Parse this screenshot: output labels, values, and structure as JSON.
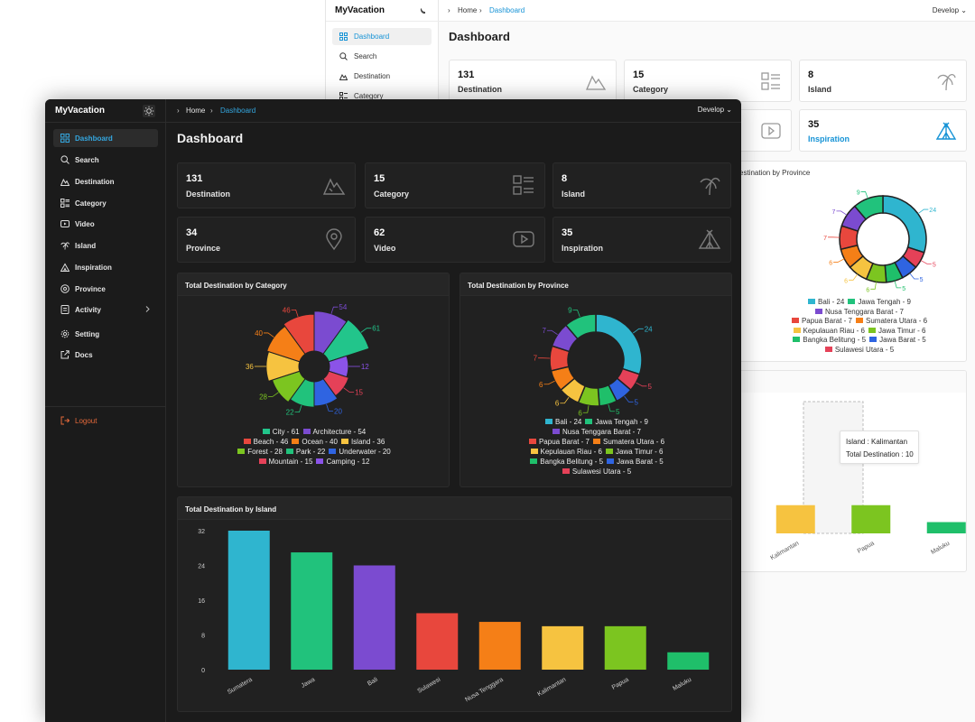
{
  "app": {
    "name": "MyVacation",
    "environment": "Develop"
  },
  "breadcrumb": {
    "home": "Home",
    "current": "Dashboard"
  },
  "page_title": "Dashboard",
  "sidebar": {
    "items": [
      {
        "label": "Dashboard",
        "icon": "dashboard-icon"
      },
      {
        "label": "Search",
        "icon": "search-icon"
      },
      {
        "label": "Destination",
        "icon": "mountain-icon"
      },
      {
        "label": "Category",
        "icon": "category-list-icon"
      },
      {
        "label": "Video",
        "icon": "video-icon"
      },
      {
        "label": "Island",
        "icon": "palm-tree-icon"
      },
      {
        "label": "Inspiration",
        "icon": "tent-icon"
      },
      {
        "label": "Province",
        "icon": "map-pin-icon"
      },
      {
        "label": "Activity",
        "icon": "activity-icon"
      },
      {
        "label": "Setting",
        "icon": "gear-icon"
      },
      {
        "label": "Docs",
        "icon": "external-link-icon"
      }
    ],
    "logout": "Logout"
  },
  "stats": [
    {
      "value": "131",
      "label": "Destination",
      "icon": "mountain-icon"
    },
    {
      "value": "15",
      "label": "Category",
      "icon": "category-list-icon"
    },
    {
      "value": "8",
      "label": "Island",
      "icon": "palm-tree-icon"
    },
    {
      "value": "34",
      "label": "Province",
      "icon": "map-pin-icon"
    },
    {
      "value": "62",
      "label": "Video",
      "icon": "video-icon"
    },
    {
      "value": "35",
      "label": "Inspiration",
      "icon": "tent-icon"
    }
  ],
  "light_window": {
    "nav": [
      "Dashboard",
      "Search",
      "Destination",
      "Category"
    ],
    "tooltip": {
      "line1": "Island : Kalimantan",
      "line2": "Total Destination : 10"
    },
    "province_title_fragment": "estination by Province"
  },
  "colors": {
    "accent": "#34a7e0",
    "bg_dark": "#1b1b1b",
    "panel_dark": "#212121",
    "logout": "#e5693a"
  },
  "chart_data": [
    {
      "type": "pie",
      "title": "Total Destination by Category",
      "series": [
        {
          "name": "City",
          "value": 61,
          "color": "#22c58b"
        },
        {
          "name": "Architecture",
          "value": 54,
          "color": "#7b4bd0"
        },
        {
          "name": "Beach",
          "value": 46,
          "color": "#e8473d"
        },
        {
          "name": "Ocean",
          "value": 40,
          "color": "#f57f17"
        },
        {
          "name": "Island",
          "value": 36,
          "color": "#f6c340"
        },
        {
          "name": "Forest",
          "value": 28,
          "color": "#7cc520"
        },
        {
          "name": "Park",
          "value": 22,
          "color": "#21c27c"
        },
        {
          "name": "Underwater",
          "value": 20,
          "color": "#2f64e1"
        },
        {
          "name": "Mountain",
          "value": 15,
          "color": "#e54158"
        },
        {
          "name": "Camping",
          "value": 12,
          "color": "#8b53e8"
        }
      ],
      "order": [
        "Architecture",
        "City",
        "Camping",
        "Mountain",
        "Underwater",
        "Park",
        "Forest",
        "Island",
        "Ocean",
        "Beach"
      ]
    },
    {
      "type": "pie",
      "title": "Total Destination by Province",
      "series": [
        {
          "name": "Bali",
          "value": 24,
          "color": "#2fb5cf"
        },
        {
          "name": "Jawa Tengah",
          "value": 9,
          "color": "#21c27c"
        },
        {
          "name": "Nusa Tenggara Barat",
          "value": 7,
          "color": "#7b4bd0"
        },
        {
          "name": "Papua Barat",
          "value": 7,
          "color": "#e8473d"
        },
        {
          "name": "Sumatera Utara",
          "value": 6,
          "color": "#f57f17"
        },
        {
          "name": "Kepulauan Riau",
          "value": 6,
          "color": "#f6c340"
        },
        {
          "name": "Jawa Timur",
          "value": 6,
          "color": "#7cc520"
        },
        {
          "name": "Bangka Belitung",
          "value": 5,
          "color": "#1fbf6a"
        },
        {
          "name": "Jawa Barat",
          "value": 5,
          "color": "#2f64e1"
        },
        {
          "name": "Sulawesi Utara",
          "value": 5,
          "color": "#e54158"
        }
      ],
      "order": [
        "Bali",
        "Sulawesi Utara",
        "Jawa Barat",
        "Bangka Belitung",
        "Jawa Timur",
        "Kepulauan Riau",
        "Sumatera Utara",
        "Papua Barat",
        "Nusa Tenggara Barat",
        "Jawa Tengah"
      ]
    },
    {
      "type": "bar",
      "title": "Total Destination by Island",
      "categories": [
        "Sumatera",
        "Jawa",
        "Bali",
        "Sulawesi",
        "Nusa Tenggara",
        "Kalimantan",
        "Papua",
        "Maluku"
      ],
      "values": [
        32,
        27,
        24,
        13,
        11,
        10,
        10,
        4
      ],
      "colors": [
        "#2fb5cf",
        "#21c27c",
        "#7b4bd0",
        "#e8473d",
        "#f57f17",
        "#f6c340",
        "#7cc520",
        "#1fbf6a"
      ],
      "ylim": [
        0,
        32
      ],
      "yticks": [
        0,
        8,
        16,
        24,
        32
      ]
    }
  ]
}
